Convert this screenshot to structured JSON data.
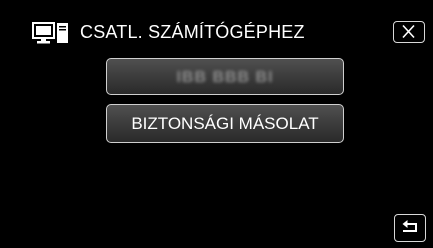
{
  "header": {
    "title": "CSATL. SZÁMÍTÓGÉPHEZ",
    "icon": "pc-connect-icon",
    "close_icon": "close-icon"
  },
  "menu": {
    "items": [
      {
        "label": "IBB BBB BI",
        "enabled": false
      },
      {
        "label": "BIZTONSÁGI MÁSOLAT",
        "enabled": true
      }
    ]
  },
  "footer": {
    "return_icon": "return-icon"
  },
  "colors": {
    "background": "#000000",
    "button_border": "#cfcfcf",
    "text": "#ffffff",
    "disabled_text": "#8a8a8a"
  }
}
